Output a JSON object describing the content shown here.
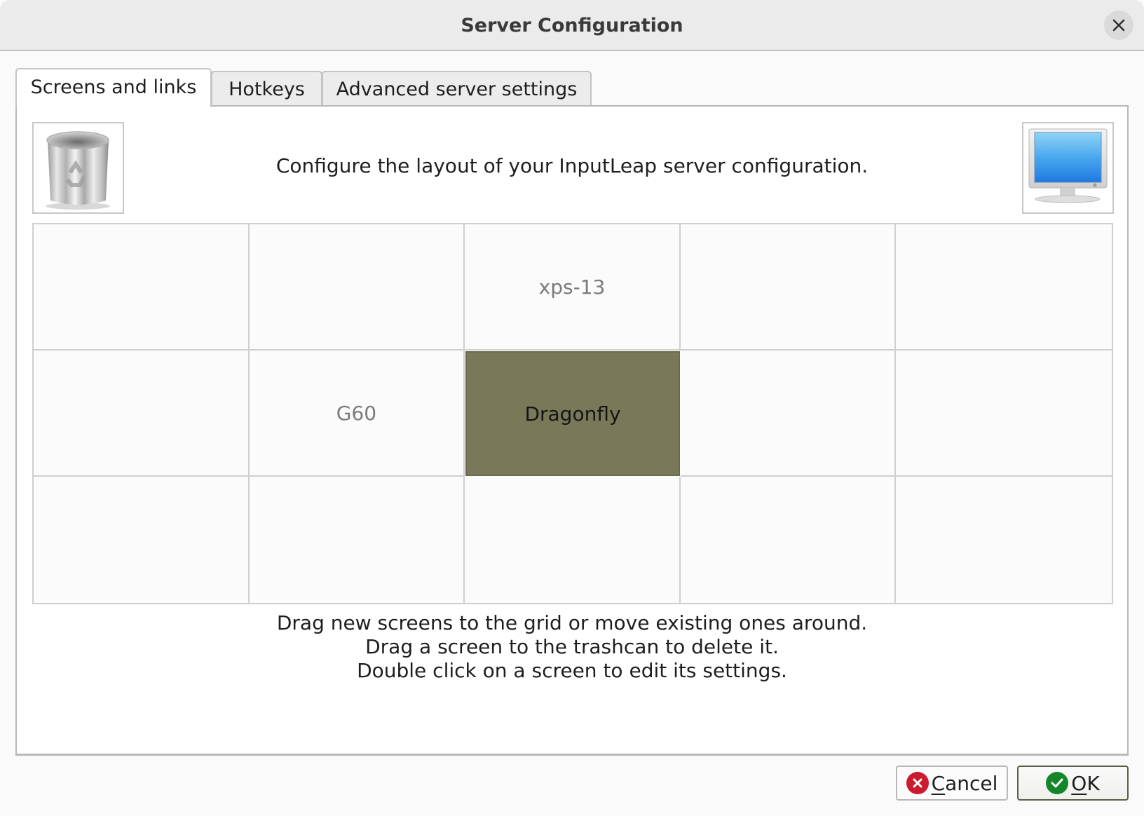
{
  "window": {
    "title": "Server Configuration",
    "close_icon": "close-icon"
  },
  "tabs": [
    {
      "label": "Screens and links",
      "active": true
    },
    {
      "label": "Hotkeys",
      "active": false
    },
    {
      "label": "Advanced server settings",
      "active": false
    }
  ],
  "screens_tab": {
    "trash_icon": "trashcan-icon",
    "new_screen_icon": "monitor-icon",
    "intro": "Configure the layout of your InputLeap server configuration.",
    "grid": {
      "columns": 5,
      "rows": 3,
      "cells": [
        [
          "",
          "",
          "xps-13",
          "",
          ""
        ],
        [
          "",
          "G60",
          "Dragonfly",
          "",
          ""
        ],
        [
          "",
          "",
          "",
          "",
          ""
        ]
      ],
      "server_screen": "Dragonfly",
      "server_color": "#79795a"
    },
    "help_lines": [
      "Drag new screens to the grid or move existing ones around.",
      "Drag a screen to the trashcan to delete it.",
      "Double click on a screen to edit its settings."
    ]
  },
  "buttons": {
    "cancel": {
      "mnemonic": "C",
      "rest": "ancel",
      "icon": "cancel-icon"
    },
    "ok": {
      "mnemonic": "O",
      "rest": "K",
      "icon": "ok-check-icon"
    }
  }
}
